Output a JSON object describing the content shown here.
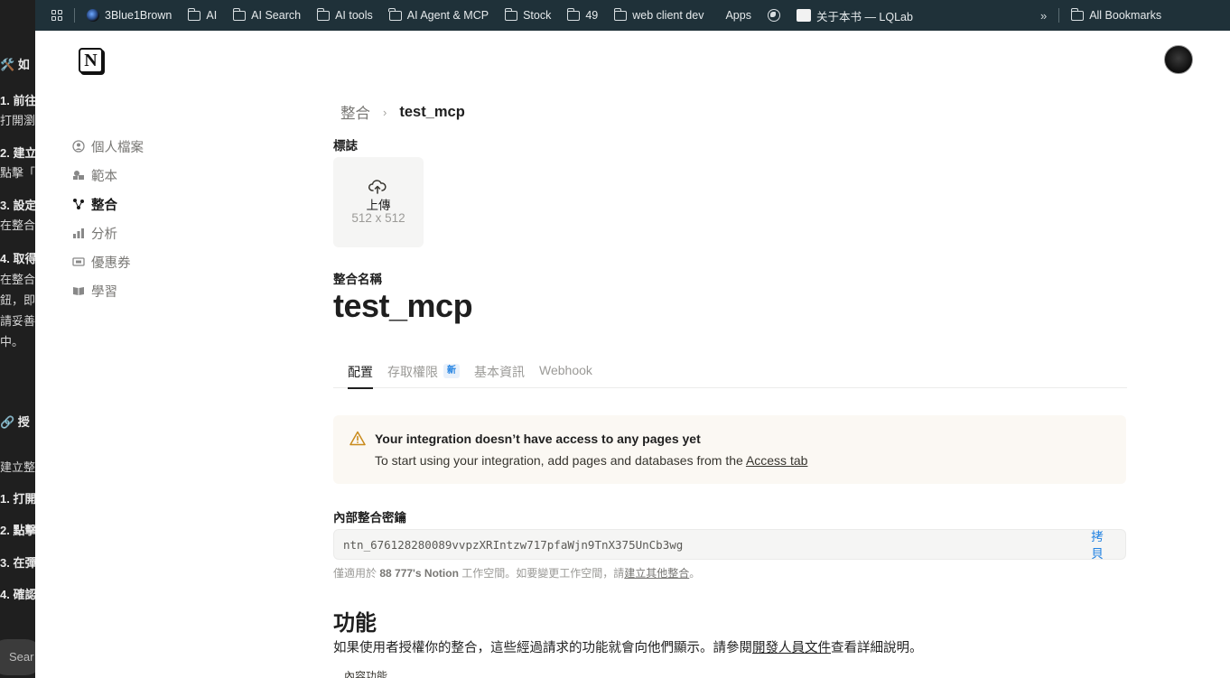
{
  "background_window": {
    "lines": [
      {
        "text": "🛠️ 如"
      },
      {
        "text": "1. 前往"
      },
      {
        "text": "打開瀏"
      },
      {
        "text": "2. 建立"
      },
      {
        "text": "點擊「"
      },
      {
        "text": "3. 設定"
      },
      {
        "text": "在整合"
      },
      {
        "text": "4. 取得"
      },
      {
        "text": "在整合"
      },
      {
        "text": "鈕，即"
      },
      {
        "text": "請妥善"
      },
      {
        "text": "中。"
      },
      {
        "text": "🔗 授"
      },
      {
        "text": "建立整"
      },
      {
        "text": "1. 打開"
      },
      {
        "text": "2. 點擊"
      },
      {
        "text": "3. 在彈"
      },
      {
        "text": "4. 確認"
      }
    ],
    "search_pill": "Sear"
  },
  "bookmarks_bar": {
    "items": [
      {
        "label": "3Blue1Brown",
        "icon": "3blue1brown-icon"
      },
      {
        "label": "AI",
        "icon": "folder-icon"
      },
      {
        "label": "AI Search",
        "icon": "folder-icon"
      },
      {
        "label": "AI tools",
        "icon": "folder-icon"
      },
      {
        "label": "AI Agent & MCP",
        "icon": "folder-icon"
      },
      {
        "label": "Stock",
        "icon": "folder-icon"
      },
      {
        "label": "49",
        "icon": "folder-icon"
      },
      {
        "label": "web client dev",
        "icon": "folder-icon"
      },
      {
        "label": "Apps",
        "icon": "apps-grid-icon"
      },
      {
        "label": "",
        "icon": "globe-icon"
      },
      {
        "label": "关于本书 — LQLab",
        "icon": "site-favicon"
      }
    ],
    "overflow_glyph": "»",
    "all_bookmarks": "All Bookmarks"
  },
  "sidebar": {
    "items": [
      {
        "label": "個人檔案",
        "icon": "profile-icon"
      },
      {
        "label": "範本",
        "icon": "templates-icon"
      },
      {
        "label": "整合",
        "icon": "integrations-icon"
      },
      {
        "label": "分析",
        "icon": "analytics-icon"
      },
      {
        "label": "優惠券",
        "icon": "coupon-icon"
      },
      {
        "label": "學習",
        "icon": "book-icon"
      }
    ],
    "active_index": 2
  },
  "breadcrumb": {
    "parent": "整合",
    "separator": "›",
    "current": "test_mcp"
  },
  "logo_section": {
    "label": "標誌",
    "upload_label": "上傳",
    "upload_size": "512 x 512"
  },
  "name_section": {
    "label": "整合名稱",
    "title": "test_mcp"
  },
  "tabs": [
    {
      "label": "配置",
      "active": true
    },
    {
      "label": "存取權限",
      "badge": "新"
    },
    {
      "label": "基本資訊"
    },
    {
      "label": "Webhook"
    }
  ],
  "callout": {
    "title": "Your integration doesn’t have access to any pages yet",
    "body_prefix": "To start using your integration, add pages and databases from the ",
    "body_link": "Access tab"
  },
  "secret": {
    "label": "內部整合密鑰",
    "value": "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",
    "copy_label": "拷貝"
  },
  "hint": {
    "prefix": "僅適用於 ",
    "workspace": "88 777's Notion",
    "middle": " 工作空間。如要變更工作空間，請",
    "link": "建立其他整合",
    "suffix": "。"
  },
  "capabilities": {
    "heading": "功能",
    "desc_prefix": "如果使用者授權你的整合，這些經過請求的功能就會向他們顯示。請參閱",
    "desc_link": "開發人員文件",
    "desc_suffix": "查看詳細說明。",
    "subheading": "內容功能"
  },
  "colors": {
    "bookmarks_bg": "#1f3139",
    "accent_blue": "#2383e2",
    "callout_bg": "#fbf8f3",
    "warning_orange": "#c98a1b"
  }
}
